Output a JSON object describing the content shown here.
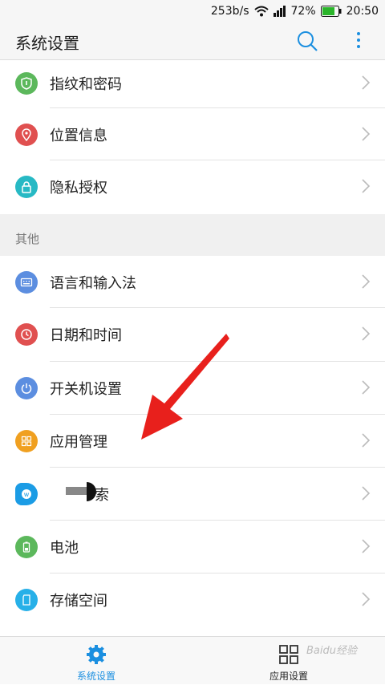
{
  "status": {
    "speed": "253b/s",
    "battery": "72%",
    "time": "20:50",
    "icons": [
      "wifi-icon",
      "signal-icon",
      "battery-icon"
    ]
  },
  "header": {
    "title": "系统设置",
    "actions": [
      "search-icon",
      "more-icon"
    ]
  },
  "list": {
    "group1": [
      {
        "label": "指纹和密码",
        "icon": "shield-icon",
        "color": "#5cb85c"
      },
      {
        "label": "位置信息",
        "icon": "location-icon",
        "color": "#e05050"
      },
      {
        "label": "隐私授权",
        "icon": "lock-icon",
        "color": "#27b9c4"
      }
    ],
    "section_title": "其他",
    "group2": [
      {
        "label": "语言和输入法",
        "icon": "keyboard-icon",
        "color": "#5c8ee0"
      },
      {
        "label": "日期和时间",
        "icon": "clock-icon",
        "color": "#e05050"
      },
      {
        "label": "开关机设置",
        "icon": "power-icon",
        "color": "#5c8ee0"
      },
      {
        "label": "应用管理",
        "icon": "apps-icon",
        "color": "#f0a020"
      },
      {
        "label": "索",
        "icon": "search-app-icon",
        "color": "#1b9ce5"
      },
      {
        "label": "电池",
        "icon": "battery-app-icon",
        "color": "#5cb85c"
      },
      {
        "label": "存储空间",
        "icon": "storage-icon",
        "color": "#27b0e8"
      }
    ]
  },
  "bottom_nav": {
    "tabs": [
      {
        "label": "系统设置",
        "icon": "gear-icon",
        "active": true
      },
      {
        "label": "应用设置",
        "icon": "grid-icon",
        "active": false
      }
    ]
  },
  "watermark": "Baidu经验",
  "colors": {
    "accent": "#1b8fe0",
    "arrow": "#e8201c"
  }
}
